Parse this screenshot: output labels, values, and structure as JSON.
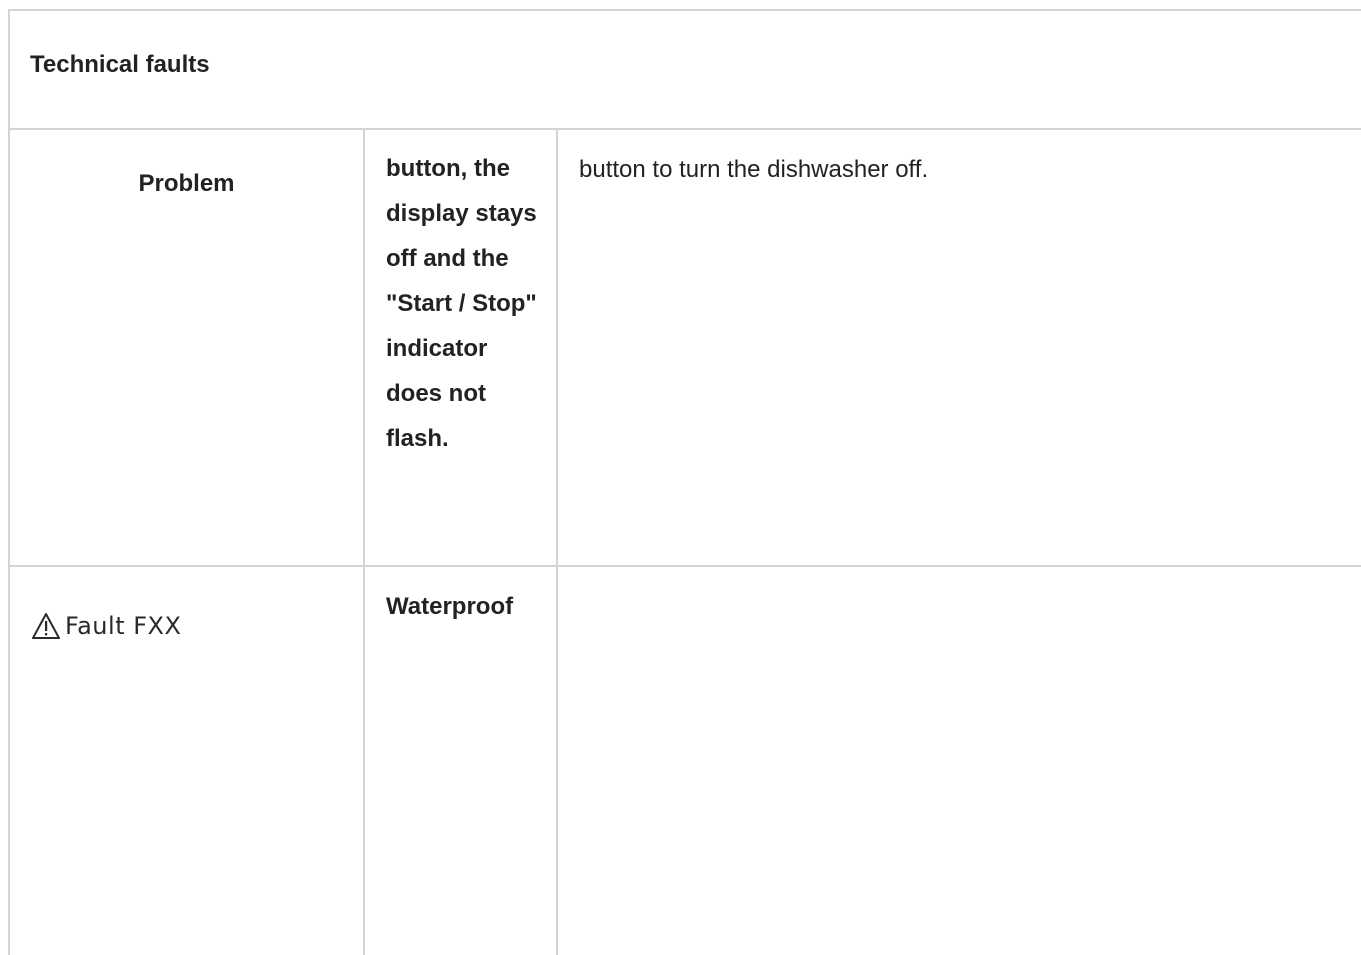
{
  "table": {
    "title": "Technical faults",
    "rows": [
      {
        "label": "Problem",
        "symptom": "button, the display stays off and the \"Start / Stop\" indicator does not flash.",
        "solution": "button to turn the dishwasher off."
      },
      {
        "fault_icon": "warning-triangle-icon",
        "fault_label": "Fault FXX",
        "symptom": "Waterproof",
        "solution": ""
      }
    ]
  }
}
